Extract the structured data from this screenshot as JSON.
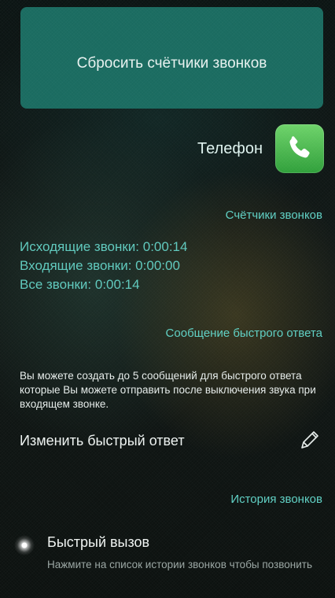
{
  "reset_button": {
    "label": "Сбросить счётчики звонков"
  },
  "phone": {
    "label": "Телефон",
    "icon": "phone-icon",
    "icon_color": "#43b94a"
  },
  "counters": {
    "heading": "Счётчики звонков",
    "outgoing": "Исходящие звонки: 0:00:14",
    "incoming": "Входящие звонки: 0:00:00",
    "all": "Все звонки: 0:00:14"
  },
  "quick_reply": {
    "heading": "Сообщение быстрого ответа",
    "description": "Вы можете создать до 5 сообщений для быстрого ответа которые Вы можете отправить после выключения звука при входящем звонке.",
    "edit_label": "Изменить быстрый ответ",
    "edit_icon": "pencil-icon"
  },
  "call_history": {
    "heading": "История звонков",
    "speed_dial_title": "Быстрый вызов",
    "speed_dial_subtitle": "Нажмите на список истории звонков чтобы позвонить"
  },
  "colors": {
    "accent": "#5fd0c4",
    "button_bg": "#1a6b60"
  }
}
